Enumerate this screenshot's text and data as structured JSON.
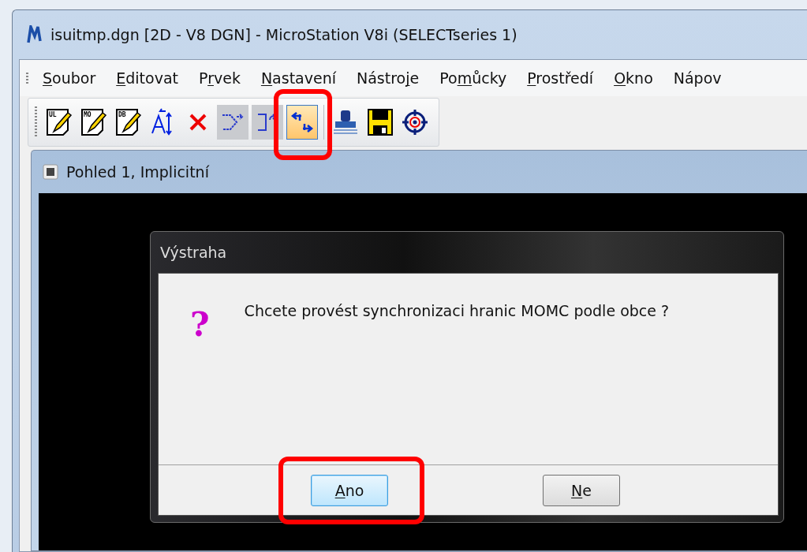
{
  "window": {
    "title": "isuitmp.dgn [2D - V8 DGN] - MicroStation V8i (SELECTseries 1)"
  },
  "menu": [
    {
      "parts": [
        {
          "text": "S",
          "underlined": true
        },
        {
          "text": "oubor",
          "underlined": false
        }
      ]
    },
    {
      "parts": [
        {
          "text": "E",
          "underlined": true
        },
        {
          "text": "ditovat",
          "underlined": false
        }
      ]
    },
    {
      "parts": [
        {
          "text": "P",
          "underlined": false
        },
        {
          "text": "r",
          "underlined": true
        },
        {
          "text": "vek",
          "underlined": false
        }
      ]
    },
    {
      "parts": [
        {
          "text": "N",
          "underlined": true
        },
        {
          "text": "astavení",
          "underlined": false
        }
      ]
    },
    {
      "parts": [
        {
          "text": "Nástro",
          "underlined": false
        },
        {
          "text": "j",
          "underlined": true
        },
        {
          "text": "e",
          "underlined": false
        }
      ]
    },
    {
      "parts": [
        {
          "text": "Po",
          "underlined": false
        },
        {
          "text": "m",
          "underlined": true
        },
        {
          "text": "ůcky",
          "underlined": false
        }
      ]
    },
    {
      "parts": [
        {
          "text": "P",
          "underlined": true
        },
        {
          "text": "rostředí",
          "underlined": false
        }
      ]
    },
    {
      "parts": [
        {
          "text": "O",
          "underlined": true
        },
        {
          "text": "kno",
          "underlined": false
        }
      ]
    },
    {
      "parts": [
        {
          "text": "Nápov",
          "underlined": false
        }
      ]
    }
  ],
  "toolbar": [
    {
      "kind": "tag-pencil",
      "tag": "UL",
      "disabled": false,
      "selected": false
    },
    {
      "kind": "tag-pencil",
      "tag": "MO",
      "disabled": false,
      "selected": false
    },
    {
      "kind": "tag-pencil",
      "tag": "DB",
      "disabled": false,
      "selected": false
    },
    {
      "kind": "text-arrows",
      "disabled": false,
      "selected": false
    },
    {
      "kind": "delete",
      "disabled": false,
      "selected": false
    },
    {
      "kind": "shape-arrow",
      "disabled": true,
      "selected": false
    },
    {
      "kind": "bracket-arrow",
      "disabled": true,
      "selected": false
    },
    {
      "kind": "sync-arrows",
      "disabled": false,
      "selected": true,
      "highlighted": true
    },
    {
      "kind": "separator"
    },
    {
      "kind": "stamp",
      "disabled": false,
      "selected": false
    },
    {
      "kind": "save",
      "disabled": false,
      "selected": false
    },
    {
      "kind": "target",
      "disabled": false,
      "selected": false
    }
  ],
  "view": {
    "title": "Pohled 1, Implicitní"
  },
  "dialog": {
    "title": "Výstraha",
    "icon": "?",
    "message": "Chcete provést synchronizaci hranic MOMC podle obce ?",
    "buttons": [
      {
        "parts": [
          {
            "text": "A",
            "underlined": true
          },
          {
            "text": "no",
            "underlined": false
          }
        ],
        "default": true,
        "highlighted": true
      },
      {
        "parts": [
          {
            "text": "N",
            "underlined": true
          },
          {
            "text": "e",
            "underlined": false
          }
        ],
        "default": false
      }
    ]
  }
}
